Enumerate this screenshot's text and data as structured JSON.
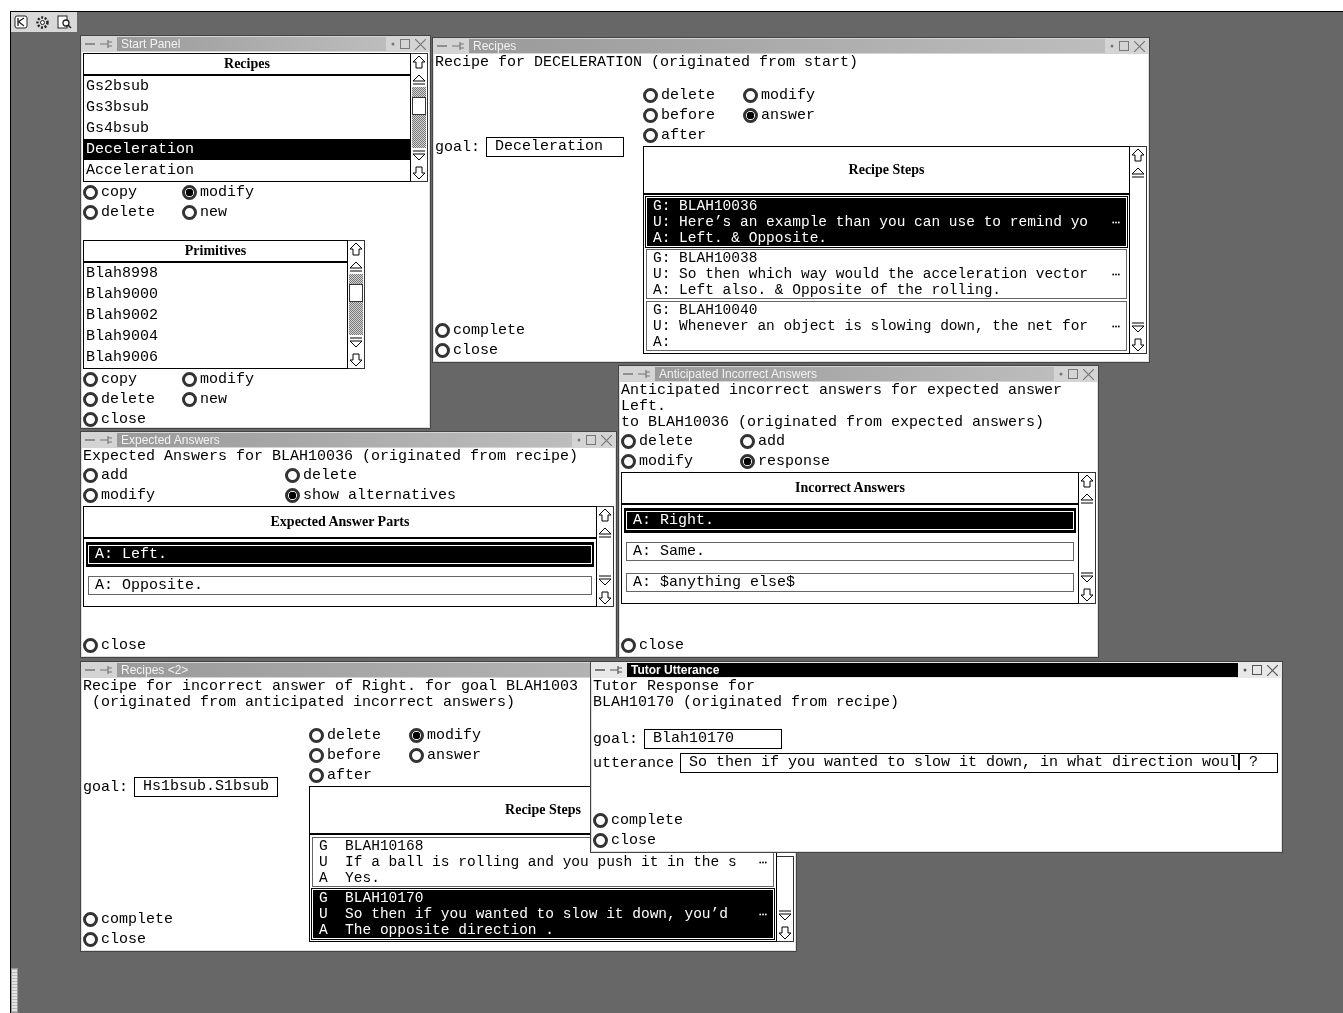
{
  "windows": [
    {
      "kind": "start_panel",
      "title": "Start Panel",
      "active": false,
      "recipes": {
        "header": "Recipes",
        "items": [
          {
            "label": "Gs2bsub",
            "selected": false
          },
          {
            "label": "Gs3bsub",
            "selected": false
          },
          {
            "label": "Gs4bsub",
            "selected": false
          },
          {
            "label": "Deceleration",
            "selected": true
          },
          {
            "label": "Acceleration",
            "selected": false
          }
        ]
      },
      "recipe_options": [
        {
          "label": "copy",
          "selected": false
        },
        {
          "label": "modify",
          "selected": true
        },
        {
          "label": "delete",
          "selected": false
        },
        {
          "label": "new",
          "selected": false
        }
      ],
      "primitives": {
        "header": "Primitives",
        "items": [
          {
            "label": "Blah8998",
            "selected": false
          },
          {
            "label": "Blah9000",
            "selected": false
          },
          {
            "label": "Blah9002",
            "selected": false
          },
          {
            "label": "Blah9004",
            "selected": false
          },
          {
            "label": "Blah9006",
            "selected": false
          }
        ]
      },
      "primitive_options": [
        {
          "label": "copy",
          "selected": false
        },
        {
          "label": "modify",
          "selected": false
        },
        {
          "label": "delete",
          "selected": false
        },
        {
          "label": "new",
          "selected": false
        }
      ],
      "actions": [
        {
          "label": "close",
          "selected": false
        }
      ]
    },
    {
      "kind": "recipe",
      "title": "Recipes",
      "active": false,
      "heading": [
        "Recipe for DECELERATION (originated from start)"
      ],
      "options": [
        {
          "label": "delete",
          "selected": false
        },
        {
          "label": "modify",
          "selected": false
        },
        {
          "label": "before",
          "selected": false
        },
        {
          "label": "answer",
          "selected": true
        },
        {
          "label": "after",
          "selected": false
        }
      ],
      "goal": {
        "label": "goal:",
        "value": "Deceleration"
      },
      "steps": {
        "header": "Recipe Steps",
        "rows": [
          {
            "selected": true,
            "lines": [
              {
                "text": "G: BLAH10036",
                "truncated": false
              },
              {
                "text": "U: Here’s an example than you can use to remind yo",
                "truncated": true
              },
              {
                "text": "A: Left. & Opposite.",
                "truncated": false
              }
            ]
          },
          {
            "selected": false,
            "lines": [
              {
                "text": "G: BLAH10038",
                "truncated": false
              },
              {
                "text": "U: So then which way would the acceleration vector",
                "truncated": true
              },
              {
                "text": "A: Left also. & Opposite of the rolling.",
                "truncated": false
              }
            ]
          },
          {
            "selected": false,
            "lines": [
              {
                "text": "G: BLAH10040",
                "truncated": false
              },
              {
                "text": "U: Whenever an object is slowing down, the net for",
                "truncated": true
              },
              {
                "text": "A:",
                "truncated": false
              }
            ]
          }
        ]
      },
      "actions": [
        {
          "label": "complete",
          "selected": false
        },
        {
          "label": "close",
          "selected": false
        }
      ]
    },
    {
      "kind": "expected_answers",
      "title": "Expected Answers",
      "active": false,
      "heading": [
        "Expected Answers for BLAH10036 (originated from recipe)"
      ],
      "options": [
        {
          "label": "add",
          "selected": false
        },
        {
          "label": "delete",
          "selected": false
        },
        {
          "label": "modify",
          "selected": false
        },
        {
          "label": "show alternatives",
          "selected": true
        }
      ],
      "answers": {
        "header": "Expected Answer Parts",
        "items": [
          {
            "text": "A: Left.",
            "selected": true
          },
          {
            "text": "A: Opposite.",
            "selected": false
          }
        ]
      },
      "actions": [
        {
          "label": "close",
          "selected": false
        }
      ]
    },
    {
      "kind": "incorrect_answers",
      "title": "Anticipated Incorrect Answers",
      "active": false,
      "heading": [
        "Anticipated incorrect answers for expected answer",
        "Left.",
        "to BLAH10036 (originated from expected answers)"
      ],
      "options": [
        {
          "label": "delete",
          "selected": false
        },
        {
          "label": "add",
          "selected": false
        },
        {
          "label": "modify",
          "selected": false
        },
        {
          "label": "response",
          "selected": true
        }
      ],
      "answers": {
        "header": "Incorrect Answers",
        "items": [
          {
            "text": "A: Right.",
            "selected": true
          },
          {
            "text": "A: Same.",
            "selected": false
          },
          {
            "text": "A: $anything else$",
            "selected": false
          }
        ]
      },
      "actions": [
        {
          "label": "close",
          "selected": false
        }
      ]
    },
    {
      "kind": "recipe",
      "title": "Recipes <2>",
      "active": false,
      "heading": [
        "Recipe for incorrect answer of Right. for goal BLAH1003",
        " (originated from anticipated incorrect answers)"
      ],
      "options": [
        {
          "label": "delete",
          "selected": false
        },
        {
          "label": "modify",
          "selected": true
        },
        {
          "label": "before",
          "selected": false
        },
        {
          "label": "answer",
          "selected": false
        },
        {
          "label": "after",
          "selected": false
        }
      ],
      "goal": {
        "label": "goal:",
        "value": "Hs1bsub.S1bsub"
      },
      "steps": {
        "header": "Recipe Steps",
        "rows": [
          {
            "selected": false,
            "lines": [
              {
                "text": "G  BLAH10168",
                "truncated": false
              },
              {
                "text": "U  If a ball is rolling and you push it in the s",
                "truncated": true
              },
              {
                "text": "A  Yes.",
                "truncated": false
              }
            ]
          },
          {
            "selected": true,
            "lines": [
              {
                "text": "G  BLAH10170",
                "truncated": false
              },
              {
                "text": "U  So then if you wanted to slow it down, you’d",
                "truncated": true
              },
              {
                "text": "A  The opposite direction .",
                "truncated": false
              }
            ]
          }
        ]
      },
      "actions": [
        {
          "label": "complete",
          "selected": false
        },
        {
          "label": "close",
          "selected": false
        }
      ]
    },
    {
      "kind": "tutor_utterance",
      "title": "Tutor Utterance",
      "active": true,
      "heading": [
        "Tutor Response for",
        "BLAH10170 (originated from recipe)"
      ],
      "goal": {
        "label": "goal:",
        "value": "Blah10170"
      },
      "utterance": {
        "label": "utterance",
        "value": "So then if you wanted to slow it down, in what direction woul",
        "after_cursor": "?"
      },
      "actions": [
        {
          "label": "complete",
          "selected": false
        },
        {
          "label": "close",
          "selected": false
        }
      ]
    }
  ]
}
